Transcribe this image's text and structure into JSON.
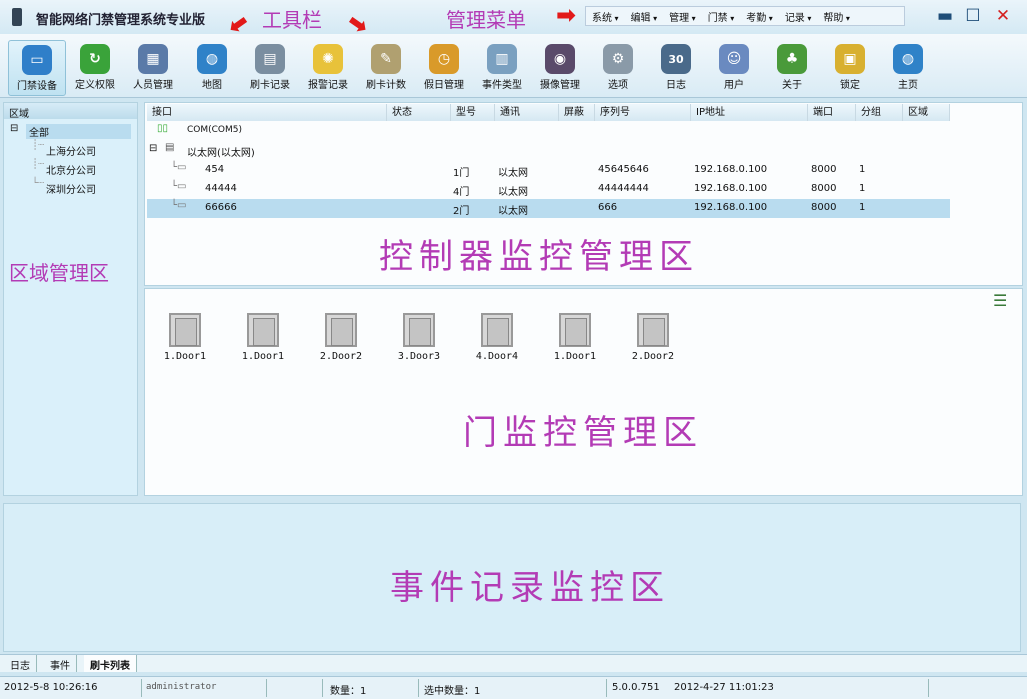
{
  "window": {
    "title": "智能网络门禁管理系统专业版"
  },
  "annotations": {
    "toolbar": "工具栏",
    "menu": "管理菜单",
    "area": "区域管理区",
    "controller": "控制器监控管理区",
    "door": "门监控管理区",
    "event": "事件记录监控区"
  },
  "menu": [
    "系统",
    "编辑",
    "管理",
    "门禁",
    "考勤",
    "记录",
    "帮助"
  ],
  "toolbar": [
    {
      "label": "门禁设备",
      "icon": "monitor-icon",
      "color": "#2f7fc9"
    },
    {
      "label": "定义权限",
      "icon": "refresh-icon",
      "color": "#3aa33a"
    },
    {
      "label": "人员管理",
      "icon": "calendar-icon",
      "color": "#5a7aa8"
    },
    {
      "label": "地图",
      "icon": "globe-icon",
      "color": "#2f82c8"
    },
    {
      "label": "刷卡记录",
      "icon": "table-icon",
      "color": "#7a8ea0"
    },
    {
      "label": "报警记录",
      "icon": "lightbulb-icon",
      "color": "#e8c23a"
    },
    {
      "label": "刷卡计数",
      "icon": "notepad-icon",
      "color": "#b0a070"
    },
    {
      "label": "假日管理",
      "icon": "clock-icon",
      "color": "#d99a2a"
    },
    {
      "label": "事件类型",
      "icon": "chart-icon",
      "color": "#7aa0c0"
    },
    {
      "label": "摄像管理",
      "icon": "camera-icon",
      "color": "#5a4a6a"
    },
    {
      "label": "选项",
      "icon": "gear-icon",
      "color": "#8a9aa8"
    },
    {
      "label": "日志",
      "icon": "calendar-30-icon",
      "color": "#4a6a8a"
    },
    {
      "label": "用户",
      "icon": "users-icon",
      "color": "#6a8ac0"
    },
    {
      "label": "关于",
      "icon": "tree-icon",
      "color": "#4a9a3a"
    },
    {
      "label": "锁定",
      "icon": "lock-icon",
      "color": "#d8b030"
    },
    {
      "label": "主页",
      "icon": "home-globe-icon",
      "color": "#2f82c8"
    }
  ],
  "area_panel": {
    "header": "区域",
    "root": "全部",
    "children": [
      "上海分公司",
      "北京分公司",
      "深圳分公司"
    ]
  },
  "controller_table": {
    "columns": [
      "接口",
      "状态",
      "型号",
      "通讯",
      "屏蔽",
      "序列号",
      "IP地址",
      "端口",
      "分组",
      "区域"
    ],
    "nodes": {
      "com": "COM(COM5)",
      "ethernet": "以太网(以太网)"
    },
    "rows": [
      {
        "name": "454",
        "model": "1门",
        "comm": "以太网",
        "serial": "45645646",
        "ip": "192.168.0.100",
        "port": "8000",
        "group": "1"
      },
      {
        "name": "44444",
        "model": "4门",
        "comm": "以太网",
        "serial": "44444444",
        "ip": "192.168.0.100",
        "port": "8000",
        "group": "1"
      },
      {
        "name": "66666",
        "model": "2门",
        "comm": "以太网",
        "serial": "666",
        "ip": "192.168.0.100",
        "port": "8000",
        "group": "1"
      }
    ]
  },
  "doors": [
    "1.Door1",
    "1.Door1",
    "2.Door2",
    "3.Door3",
    "4.Door4",
    "1.Door1",
    "2.Door2"
  ],
  "tabs": [
    "日志",
    "事件",
    "刷卡列表"
  ],
  "status": {
    "datetime": "2012-5-8 10:26:16",
    "user": "administrator",
    "count": "数量：1",
    "selected": "选中数量：1",
    "version": "5.0.0.751",
    "build_date": "2012-4-27 11:01:23"
  },
  "colors": {
    "annotation": "#b33bb5",
    "arrow": "#e21919",
    "selected_row": "#b9dcef"
  }
}
